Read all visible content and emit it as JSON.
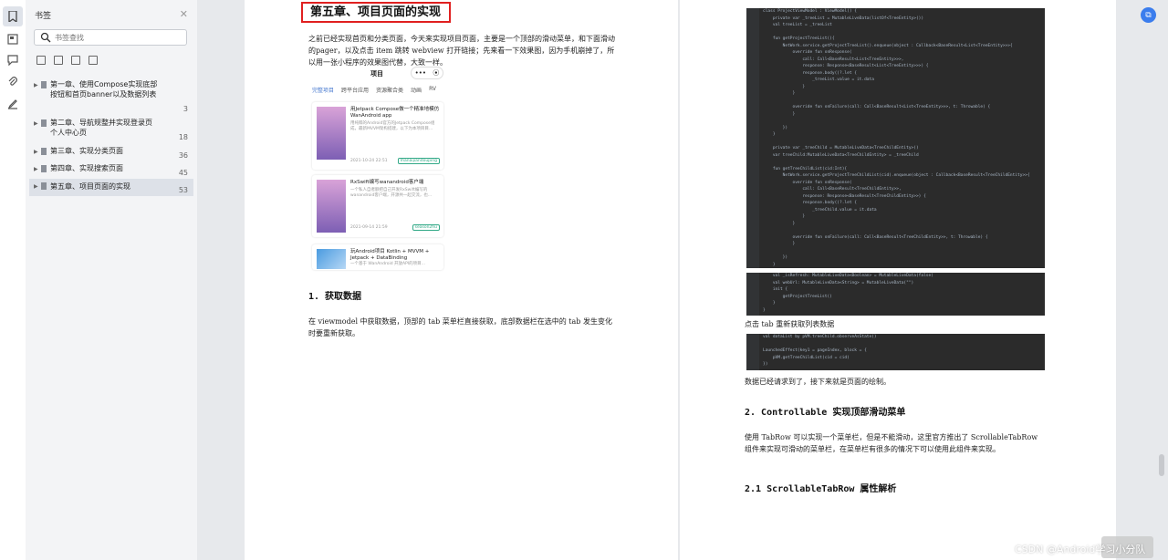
{
  "sidebar": {
    "title": "书签",
    "search_placeholder": "书签查找",
    "items": [
      {
        "label": "第一章、使用Compose实现底部按钮和首页banner以及数据列表",
        "page": "3"
      },
      {
        "label": "第二章、导航规整并实现登录页个人中心页",
        "page": "18"
      },
      {
        "label": "第三章、实现分类页面",
        "page": "36"
      },
      {
        "label": "第四章、实现搜索页面",
        "page": "45"
      },
      {
        "label": "第五章、项目页面的实现",
        "page": "53"
      }
    ]
  },
  "doc": {
    "chapter_title": "第五章、项目页面的实现",
    "intro": "之前已经实现首页和分类页面，今天来实现项目页面，主要是一个顶部的滑动菜单，和下面滑动的pager，以及点击 item 跳转 webview 打开链接；先来看一下效果图，因为手机崩掉了，所以用一张小程序的效果图代替，大致一样。",
    "phone": {
      "title": "项目",
      "tabs": [
        "完整项目",
        "跨平台应用",
        "资源聚合类",
        "动画",
        "RV"
      ],
      "cards": [
        {
          "title": "用Jetpack Compose做一个精准地模仿WanAndroid app",
          "desc": "用纯粹的Android官方的Jetpack Compose组成，最新MVVM架构搭建，以下为本项目目...",
          "date": "2021-10-24 22:51",
          "tag": "manaijiandouping"
        },
        {
          "title": "RxSwift编写wanandroid客户端",
          "desc": "一个私人自者额把自己开发RxSwift编写的wanandroid客户端，开源共一起交流，也...",
          "date": "2021-09-14 21:59",
          "tag": "season2hu"
        },
        {
          "title": "玩Android项目 Kotlin + MVVM + Jetpack + DataBinding",
          "desc": "一个基于 WanAndroid 开放API的项目...",
          "date": "",
          "tag": ""
        }
      ]
    },
    "section1_title": "1. 获取数据",
    "section1_text": "在 viewmodel 中获取数据，顶部的 tab 菜单栏直接获取，底部数据栏在选中的 tab 发生变化时要重新获取。",
    "caption_refetch": "点击 tab 重新获取列表数据",
    "caption_done": "数据已经请求到了，接下来就是页面的绘制。",
    "section2_title": "2. Controllable 实现顶部滑动菜单",
    "section2_text": "使用 TabRow 可以实现一个菜单栏，但是不能滑动，这里官方推出了 ScrollableTabRow 组件来实现可滑动的菜单栏，在菜单栏有很多的情况下可以使用此组件来实现。",
    "section21_title": "2.1 ScrollableTabRow 属性解析",
    "code1": [
      "class ProjectViewModel : ViewModel() {",
      "    private var _treeList = MutableLiveData(listOf<TreeEntity>())",
      "    val treeList = _treeList",
      "",
      "    fun getProjectTreeList(){",
      "        NetWork.service.getProjectTreeList().enqueue(object : Callback<BaseResult<List<TreeEntity>>>{",
      "            override fun onResponse(",
      "                call: Call<BaseResult<List<TreeEntity>>>,",
      "                response: Response<BaseResult<List<TreeEntity>>>) {",
      "                response.body()?.let {",
      "                    _treeList.value = it.data",
      "                }",
      "            }",
      "",
      "            override fun onFailure(call: Call<BaseResult<List<TreeEntity>>>, t: Throwable) {",
      "            }",
      "",
      "        })",
      "    }",
      "",
      "    private var _treeChild = MutableLiveData<TreeChildEntity>()",
      "    var treeChild:MutableLiveData<TreeChildEntity> = _treeChild",
      "",
      "    fun getTreeChildList(cid:Int){",
      "        NetWork.service.getProjectTreeChildList(cid).enqueue(object : Callback<BaseResult<TreeChildEntity>>{",
      "            override fun onResponse(",
      "                call: Call<BaseResult<TreeChildEntity>>,",
      "                response: Response<BaseResult<TreeChildEntity>>) {",
      "                response.body()?.let {",
      "                    _treeChild.value = it.data",
      "                }",
      "            }",
      "",
      "            override fun onFailure(call: Call<BaseResult<TreeChildEntity>>, t: Throwable) {",
      "            }",
      "",
      "        })",
      "    }"
    ],
    "code2": [
      "    val _isRefresh: MutableLiveData<Boolean> = MutableLiveData(false)",
      "    val webUrl: MutableLiveData<String> = MutableLiveData(\"\")",
      "    init {",
      "        getProjectTreeList()",
      "    }",
      "}"
    ],
    "code3": [
      "val dataList by pVM.treeChild.observeAsState()",
      "",
      "LaunchedEffect(key1 = pageIndex, block = {",
      "    pVM.getTreeChildList(cid = cid)",
      "})"
    ]
  },
  "watermark": "CSDN @Android学习小分队"
}
